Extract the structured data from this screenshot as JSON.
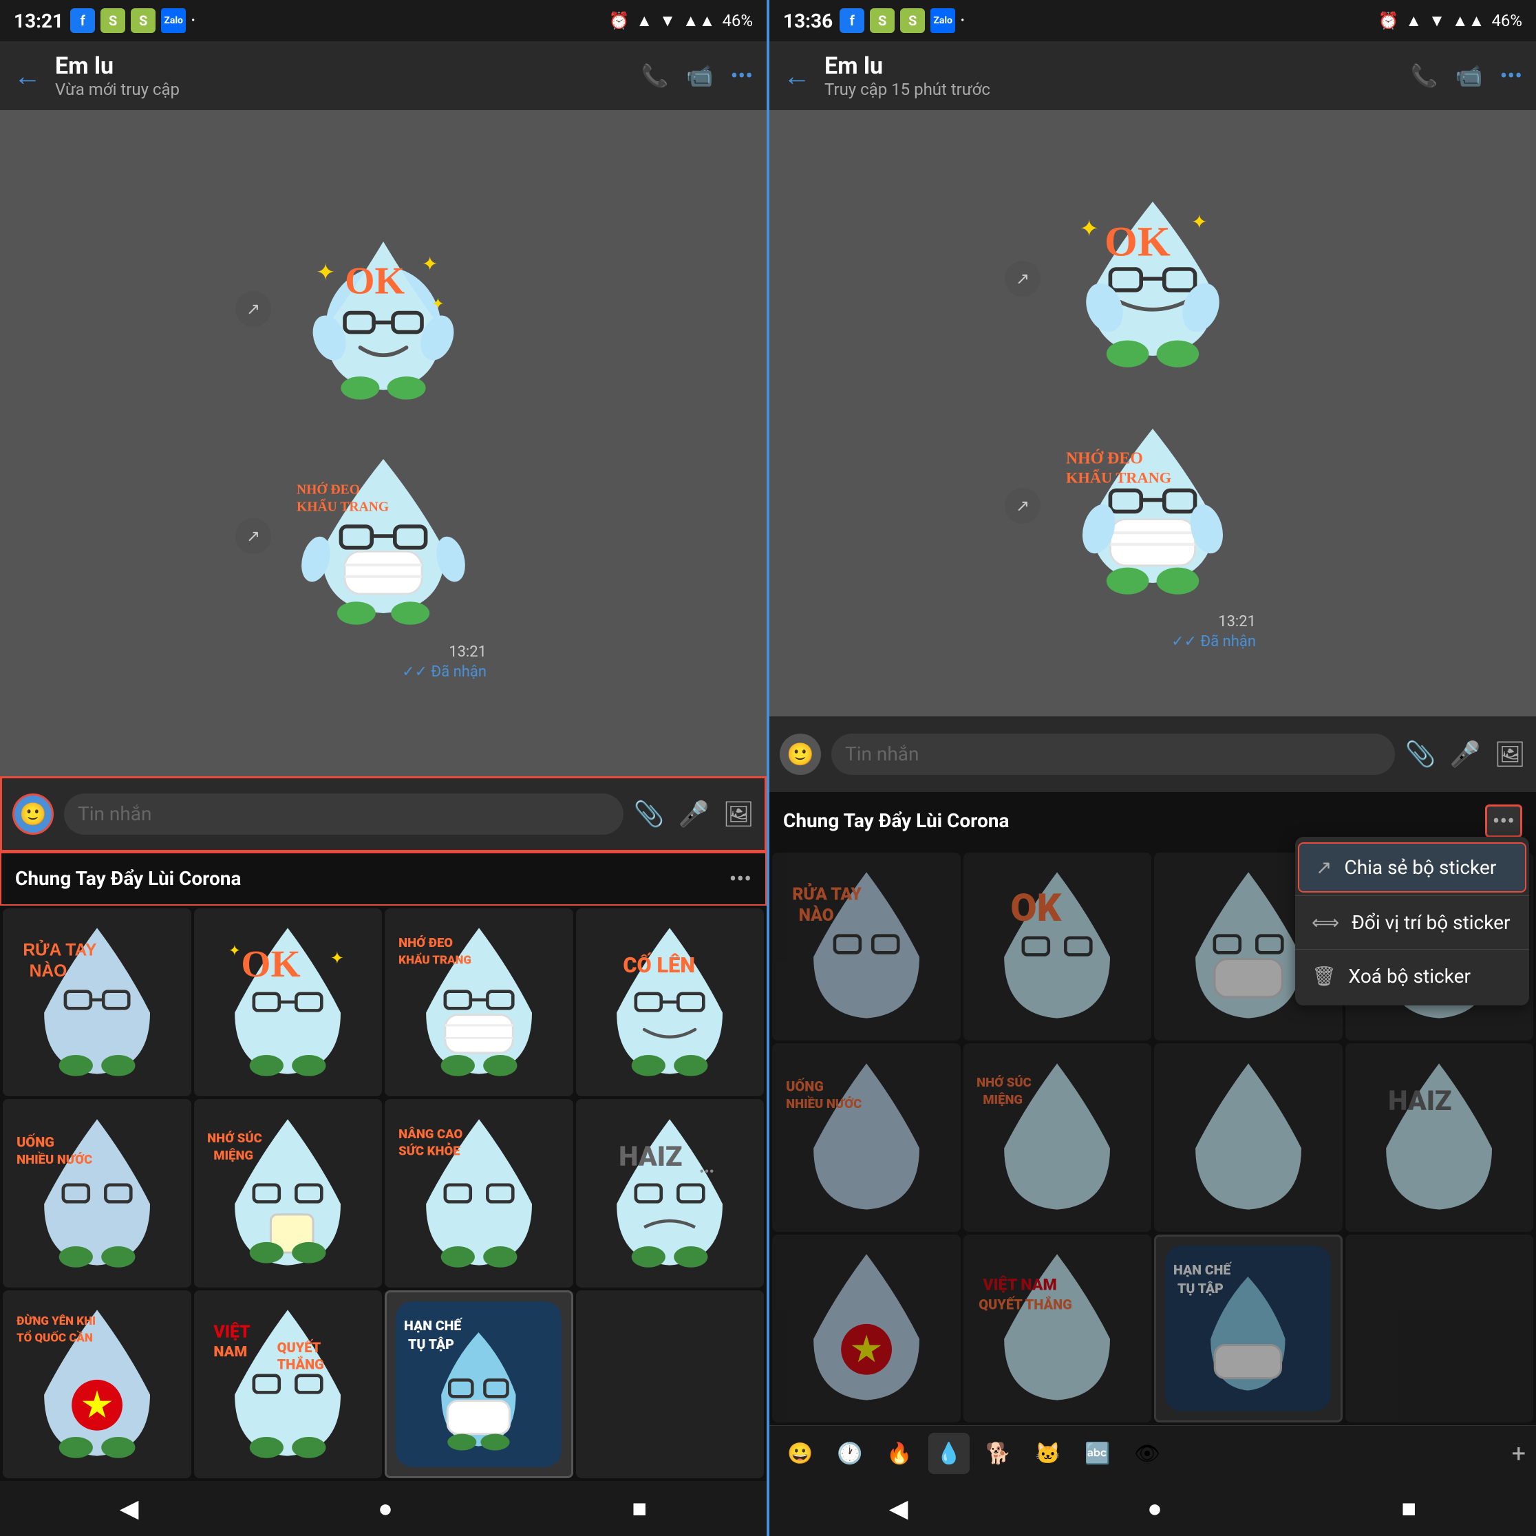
{
  "panel1": {
    "statusBar": {
      "time": "13:21",
      "battery": "46%"
    },
    "header": {
      "name": "Em lu",
      "status": "Vừa mới truy cập",
      "backLabel": "←"
    },
    "messages": [
      {
        "type": "sticker",
        "label": "OK sticker",
        "time": "13:21"
      },
      {
        "type": "sticker",
        "label": "Mask sticker",
        "receivedText": "✓✓ Đã nhận"
      }
    ],
    "inputPlaceholder": "Tin nhắn",
    "stickerPack": {
      "name": "Chung Tay Đẩy Lùi Corona",
      "moreLabel": "•••"
    },
    "stickers": [
      {
        "label": "RỬA TAY NÀO",
        "type": "wash"
      },
      {
        "label": "OK",
        "type": "ok"
      },
      {
        "label": "NHỚ ĐEO KHẨU TRANG",
        "type": "mask"
      },
      {
        "label": "CỐ LÊN",
        "type": "cheer"
      },
      {
        "label": "UỐNG NHIỀU NƯỚC",
        "type": "drink"
      },
      {
        "label": "NHỚ SÚC MIỆNG",
        "type": "gargle"
      },
      {
        "label": "NÂNG CAO SỨC KHỎE",
        "type": "health"
      },
      {
        "label": "HAIZ",
        "type": "haiz"
      },
      {
        "label": "ĐỪNG VÊN KHI TỔ QUỐC CẦN",
        "type": "flag"
      },
      {
        "label": "VIỆT NAM QUYẾT THẮNG",
        "type": "vn"
      },
      {
        "label": "HẠN CHẾ TỤ TẬP",
        "type": "stay"
      },
      {
        "label": "",
        "type": "empty"
      }
    ],
    "navButtons": [
      "◀",
      "●",
      "■"
    ]
  },
  "panel2": {
    "statusBar": {
      "time": "13:36",
      "battery": "46%"
    },
    "header": {
      "name": "Em lu",
      "status": "Truy cập 15 phút trước",
      "backLabel": "←"
    },
    "inputPlaceholder": "Tin nhắn",
    "stickerPack": {
      "name": "Chung Tay Đẩy Lùi Corona",
      "moreLabel": "•••"
    },
    "contextMenu": {
      "items": [
        {
          "icon": "↗",
          "label": "Chia sẻ bộ sticker",
          "highlighted": true
        },
        {
          "icon": "⟺",
          "label": "Đổi vị trí bộ sticker",
          "highlighted": false
        },
        {
          "icon": "🗑",
          "label": "Xoá bộ sticker",
          "highlighted": false
        }
      ]
    },
    "stickerTabs": [
      {
        "icon": "😀",
        "type": "emoji"
      },
      {
        "icon": "🕐",
        "type": "recent"
      },
      {
        "icon": "🔥",
        "type": "trending"
      },
      {
        "icon": "💧",
        "type": "pack1",
        "active": true
      },
      {
        "icon": "🐕",
        "type": "pack2"
      },
      {
        "icon": "🐱",
        "type": "pack3"
      },
      {
        "icon": "🔤",
        "type": "text"
      },
      {
        "icon": "👁",
        "type": "pack4"
      }
    ],
    "navButtons": [
      "◀",
      "●",
      "■"
    ]
  }
}
